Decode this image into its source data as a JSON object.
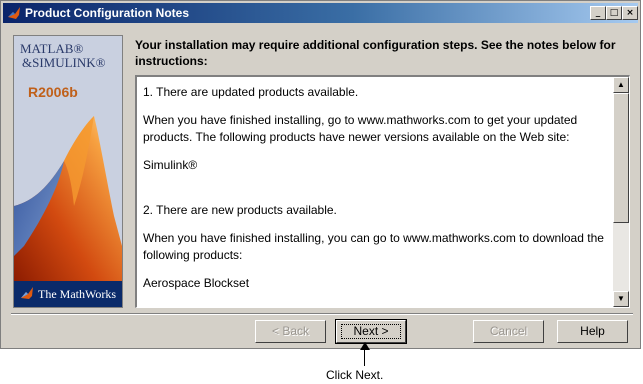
{
  "window": {
    "title": "Product Configuration Notes",
    "icon": "matlab-logo-icon",
    "controls": {
      "minimize": "_",
      "maximize": "□",
      "close": "×"
    }
  },
  "splash": {
    "title_line1": "MATLAB®",
    "title_line2": "&SIMULINK®",
    "release": "R2006b",
    "footer": "The MathWorks"
  },
  "heading": "Your installation may require additional configuration steps.  See the notes below for instructions:",
  "notes": {
    "section1_title": "1. There are updated products available.",
    "section1_body": "When you have finished installing, go to www.mathworks.com to get your updated products.  The following products have newer versions available on the Web site:",
    "section1_item": "Simulink®",
    "section2_title": "2. There are new products available.",
    "section2_body": "When you have finished installing, you can go to www.mathworks.com to download the following products:",
    "section2_item": "Aerospace Blockset",
    "scroll_up": "▲",
    "scroll_down": "▼"
  },
  "buttons": {
    "back": "< Back",
    "next": "Next >",
    "cancel": "Cancel",
    "help": "Help"
  },
  "callout": "Click Next."
}
